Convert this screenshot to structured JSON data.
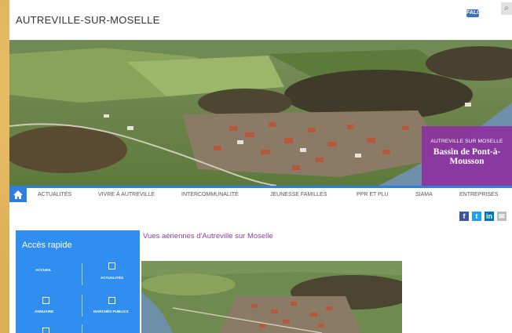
{
  "header": {
    "site_title": "AUTREVILLE-SUR-MOSELLE",
    "a11y_label": "FALC",
    "search_icon": "search-icon"
  },
  "hero": {
    "badge_small": "AUTREVILLE SUR MOSELLE",
    "badge_title": "Bassin de Pont-à-Mousson"
  },
  "nav": {
    "home_icon": "home-icon",
    "items": [
      "ACTUALITÉS",
      "VIVRE À AUTREVILLE",
      "INTERCOMMUNALITÉ",
      "JEUNESSE FAMILLES",
      "PPR ET PLU",
      "SIAMA",
      "ENTREPRISES"
    ]
  },
  "social": {
    "icons": [
      "facebook-icon",
      "twitter-icon",
      "linkedin-icon",
      "email-icon"
    ],
    "colors": [
      "#3b5998",
      "#1da1f2",
      "#0077b5",
      "#bdbdbd"
    ]
  },
  "quick_access": {
    "title": "Accès rapide",
    "items": [
      "ACCUEIL",
      "ACTUALITÉS",
      "ANNUAIRE",
      "MARCHÉS PUBLICS"
    ]
  },
  "article": {
    "title": "Vues aériennes d'Autreville sur Moselle"
  },
  "colors": {
    "accent_blue": "#2f7fe0",
    "badge_purple": "#8c32a0",
    "link_purple": "#8a3ea3"
  }
}
